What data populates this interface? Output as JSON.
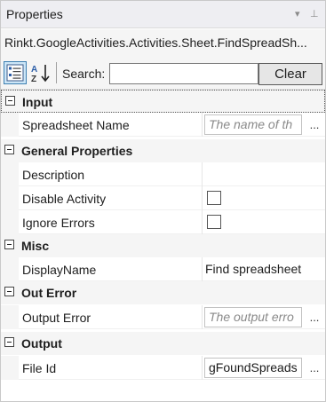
{
  "window": {
    "title": "Properties",
    "dropdown_glyph": "▾",
    "pin_glyph": "⊥"
  },
  "object_name": "Rinkt.GoogleActivities.Activities.Sheet.FindSpreadSh...",
  "toolbar": {
    "search_label": "Search:",
    "search_value": "",
    "clear_label": "Clear",
    "categorized_icon": "categorized-view-icon",
    "alpha_icon": "alphabetical-sort-icon"
  },
  "categories": {
    "input": "Input",
    "general": "General Properties",
    "misc": "Misc",
    "out_error": "Out Error",
    "output": "Output"
  },
  "properties": {
    "spreadsheet_name": {
      "label": "Spreadsheet Name",
      "placeholder": "The name of th",
      "ellipsis": "..."
    },
    "description": {
      "label": "Description",
      "value": ""
    },
    "disable_activity": {
      "label": "Disable Activity",
      "checked": false
    },
    "ignore_errors": {
      "label": "Ignore Errors",
      "checked": false
    },
    "display_name": {
      "label": "DisplayName",
      "value": "Find spreadsheet"
    },
    "output_error": {
      "label": "Output Error",
      "placeholder": "The output erro",
      "ellipsis": "..."
    },
    "file_id": {
      "label": "File Id",
      "value": "gFoundSpreads",
      "ellipsis": "..."
    }
  },
  "colors": {
    "accent": "#3c7fb1",
    "accent_fill": "#cde6f7",
    "category_bg": "#f5f5f5",
    "placeholder_text": "#8a8a8a"
  }
}
